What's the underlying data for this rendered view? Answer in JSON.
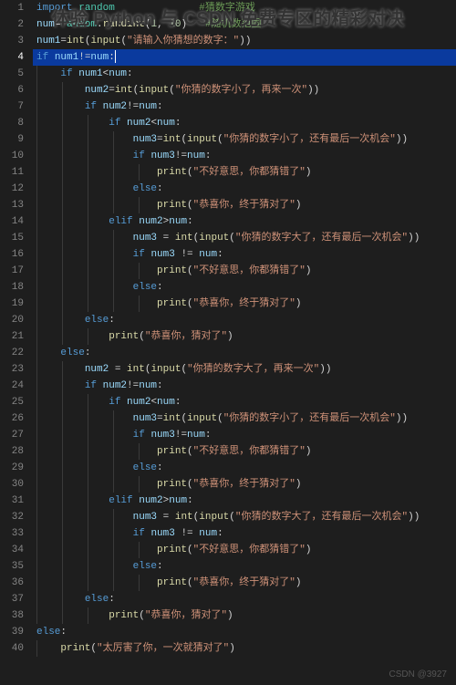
{
  "overlay_title": "体验 Python 与 CSDN 免费专区的精彩对决",
  "watermark": "CSDN @3927",
  "active_line": 4,
  "lines": [
    {
      "n": 1,
      "indent": 0,
      "tokens": [
        [
          "kw",
          "import"
        ],
        [
          "op",
          " "
        ],
        [
          "mod",
          "random"
        ],
        [
          "op",
          "              "
        ],
        [
          "cmt",
          "#猜数字游戏"
        ]
      ]
    },
    {
      "n": 2,
      "indent": 0,
      "tokens": [
        [
          "var",
          "num"
        ],
        [
          "op",
          "="
        ],
        [
          "mod",
          "random"
        ],
        [
          "punc",
          "."
        ],
        [
          "fn",
          "randint"
        ],
        [
          "punc",
          "("
        ],
        [
          "num",
          "1"
        ],
        [
          "punc",
          ", "
        ],
        [
          "num",
          "10"
        ],
        [
          "punc",
          ")   "
        ],
        [
          "cmt",
          "#随机数范围"
        ]
      ]
    },
    {
      "n": 3,
      "indent": 0,
      "tokens": [
        [
          "var",
          "num1"
        ],
        [
          "op",
          "="
        ],
        [
          "fn",
          "int"
        ],
        [
          "punc",
          "("
        ],
        [
          "fn",
          "input"
        ],
        [
          "punc",
          "("
        ],
        [
          "str",
          "\"请输入你猜想的数字：\""
        ],
        [
          "punc",
          "))"
        ]
      ]
    },
    {
      "n": 4,
      "indent": 0,
      "tokens": [
        [
          "kw",
          "if "
        ],
        [
          "var",
          "num1"
        ],
        [
          "op",
          "!="
        ],
        [
          "var",
          "num"
        ],
        [
          "punc",
          ":"
        ]
      ]
    },
    {
      "n": 5,
      "indent": 1,
      "tokens": [
        [
          "kw",
          "if "
        ],
        [
          "var",
          "num1"
        ],
        [
          "op",
          "<"
        ],
        [
          "var",
          "num"
        ],
        [
          "punc",
          ":"
        ]
      ]
    },
    {
      "n": 6,
      "indent": 2,
      "tokens": [
        [
          "var",
          "num2"
        ],
        [
          "op",
          "="
        ],
        [
          "fn",
          "int"
        ],
        [
          "punc",
          "("
        ],
        [
          "fn",
          "input"
        ],
        [
          "punc",
          "("
        ],
        [
          "str",
          "\"你猜的数字小了，再来一次\""
        ],
        [
          "punc",
          "))"
        ]
      ]
    },
    {
      "n": 7,
      "indent": 2,
      "tokens": [
        [
          "kw",
          "if "
        ],
        [
          "var",
          "num2"
        ],
        [
          "op",
          "!="
        ],
        [
          "var",
          "num"
        ],
        [
          "punc",
          ":"
        ]
      ]
    },
    {
      "n": 8,
      "indent": 3,
      "tokens": [
        [
          "kw",
          "if "
        ],
        [
          "var",
          "num2"
        ],
        [
          "op",
          "<"
        ],
        [
          "var",
          "num"
        ],
        [
          "punc",
          ":"
        ]
      ]
    },
    {
      "n": 9,
      "indent": 4,
      "tokens": [
        [
          "var",
          "num3"
        ],
        [
          "op",
          "="
        ],
        [
          "fn",
          "int"
        ],
        [
          "punc",
          "("
        ],
        [
          "fn",
          "input"
        ],
        [
          "punc",
          "("
        ],
        [
          "str",
          "\"你猜的数字小了，还有最后一次机会\""
        ],
        [
          "punc",
          "))"
        ]
      ]
    },
    {
      "n": 10,
      "indent": 4,
      "tokens": [
        [
          "kw",
          "if "
        ],
        [
          "var",
          "num3"
        ],
        [
          "op",
          "!="
        ],
        [
          "var",
          "num"
        ],
        [
          "punc",
          ":"
        ]
      ]
    },
    {
      "n": 11,
      "indent": 5,
      "tokens": [
        [
          "fn",
          "print"
        ],
        [
          "punc",
          "("
        ],
        [
          "str",
          "\"不好意思，你都猜错了\""
        ],
        [
          "punc",
          ")"
        ]
      ]
    },
    {
      "n": 12,
      "indent": 4,
      "tokens": [
        [
          "kw",
          "else"
        ],
        [
          "punc",
          ":"
        ]
      ]
    },
    {
      "n": 13,
      "indent": 5,
      "tokens": [
        [
          "fn",
          "print"
        ],
        [
          "punc",
          "("
        ],
        [
          "str",
          "\"恭喜你，终于猜对了\""
        ],
        [
          "punc",
          ")"
        ]
      ]
    },
    {
      "n": 14,
      "indent": 3,
      "tokens": [
        [
          "kw",
          "elif "
        ],
        [
          "var",
          "num2"
        ],
        [
          "op",
          ">"
        ],
        [
          "var",
          "num"
        ],
        [
          "punc",
          ":"
        ]
      ]
    },
    {
      "n": 15,
      "indent": 4,
      "tokens": [
        [
          "var",
          "num3"
        ],
        [
          "op",
          " = "
        ],
        [
          "fn",
          "int"
        ],
        [
          "punc",
          "("
        ],
        [
          "fn",
          "input"
        ],
        [
          "punc",
          "("
        ],
        [
          "str",
          "\"你猜的数字大了，还有最后一次机会\""
        ],
        [
          "punc",
          "))"
        ]
      ]
    },
    {
      "n": 16,
      "indent": 4,
      "tokens": [
        [
          "kw",
          "if "
        ],
        [
          "var",
          "num3"
        ],
        [
          "op",
          " != "
        ],
        [
          "var",
          "num"
        ],
        [
          "punc",
          ":"
        ]
      ]
    },
    {
      "n": 17,
      "indent": 5,
      "tokens": [
        [
          "fn",
          "print"
        ],
        [
          "punc",
          "("
        ],
        [
          "str",
          "\"不好意思，你都猜错了\""
        ],
        [
          "punc",
          ")"
        ]
      ]
    },
    {
      "n": 18,
      "indent": 4,
      "tokens": [
        [
          "kw",
          "else"
        ],
        [
          "punc",
          ":"
        ]
      ]
    },
    {
      "n": 19,
      "indent": 5,
      "tokens": [
        [
          "fn",
          "print"
        ],
        [
          "punc",
          "("
        ],
        [
          "str",
          "\"恭喜你，终于猜对了\""
        ],
        [
          "punc",
          ")"
        ]
      ]
    },
    {
      "n": 20,
      "indent": 2,
      "tokens": [
        [
          "kw",
          "else"
        ],
        [
          "punc",
          ":"
        ]
      ]
    },
    {
      "n": 21,
      "indent": 3,
      "tokens": [
        [
          "fn",
          "print"
        ],
        [
          "punc",
          "("
        ],
        [
          "str",
          "\"恭喜你，猜对了\""
        ],
        [
          "punc",
          ")"
        ]
      ]
    },
    {
      "n": 22,
      "indent": 1,
      "tokens": [
        [
          "kw",
          "else"
        ],
        [
          "punc",
          ":"
        ]
      ]
    },
    {
      "n": 23,
      "indent": 2,
      "tokens": [
        [
          "var",
          "num2"
        ],
        [
          "op",
          " = "
        ],
        [
          "fn",
          "int"
        ],
        [
          "punc",
          "("
        ],
        [
          "fn",
          "input"
        ],
        [
          "punc",
          "("
        ],
        [
          "str",
          "\"你猜的数字大了，再来一次\""
        ],
        [
          "punc",
          "))"
        ]
      ]
    },
    {
      "n": 24,
      "indent": 2,
      "tokens": [
        [
          "kw",
          "if "
        ],
        [
          "var",
          "num2"
        ],
        [
          "op",
          "!="
        ],
        [
          "var",
          "num"
        ],
        [
          "punc",
          ":"
        ]
      ]
    },
    {
      "n": 25,
      "indent": 3,
      "tokens": [
        [
          "kw",
          "if "
        ],
        [
          "var",
          "num2"
        ],
        [
          "op",
          "<"
        ],
        [
          "var",
          "num"
        ],
        [
          "punc",
          ":"
        ]
      ]
    },
    {
      "n": 26,
      "indent": 4,
      "tokens": [
        [
          "var",
          "num3"
        ],
        [
          "op",
          "="
        ],
        [
          "fn",
          "int"
        ],
        [
          "punc",
          "("
        ],
        [
          "fn",
          "input"
        ],
        [
          "punc",
          "("
        ],
        [
          "str",
          "\"你猜的数字小了，还有最后一次机会\""
        ],
        [
          "punc",
          "))"
        ]
      ]
    },
    {
      "n": 27,
      "indent": 4,
      "tokens": [
        [
          "kw",
          "if "
        ],
        [
          "var",
          "num3"
        ],
        [
          "op",
          "!="
        ],
        [
          "var",
          "num"
        ],
        [
          "punc",
          ":"
        ]
      ]
    },
    {
      "n": 28,
      "indent": 5,
      "tokens": [
        [
          "fn",
          "print"
        ],
        [
          "punc",
          "("
        ],
        [
          "str",
          "\"不好意思，你都猜错了\""
        ],
        [
          "punc",
          ")"
        ]
      ]
    },
    {
      "n": 29,
      "indent": 4,
      "tokens": [
        [
          "kw",
          "else"
        ],
        [
          "punc",
          ":"
        ]
      ]
    },
    {
      "n": 30,
      "indent": 5,
      "tokens": [
        [
          "fn",
          "print"
        ],
        [
          "punc",
          "("
        ],
        [
          "str",
          "\"恭喜你，终于猜对了\""
        ],
        [
          "punc",
          ")"
        ]
      ]
    },
    {
      "n": 31,
      "indent": 3,
      "tokens": [
        [
          "kw",
          "elif "
        ],
        [
          "var",
          "num2"
        ],
        [
          "op",
          ">"
        ],
        [
          "var",
          "num"
        ],
        [
          "punc",
          ":"
        ]
      ]
    },
    {
      "n": 32,
      "indent": 4,
      "tokens": [
        [
          "var",
          "num3"
        ],
        [
          "op",
          " = "
        ],
        [
          "fn",
          "int"
        ],
        [
          "punc",
          "("
        ],
        [
          "fn",
          "input"
        ],
        [
          "punc",
          "("
        ],
        [
          "str",
          "\"你猜的数字大了，还有最后一次机会\""
        ],
        [
          "punc",
          "))"
        ]
      ]
    },
    {
      "n": 33,
      "indent": 4,
      "tokens": [
        [
          "kw",
          "if "
        ],
        [
          "var",
          "num3"
        ],
        [
          "op",
          " != "
        ],
        [
          "var",
          "num"
        ],
        [
          "punc",
          ":"
        ]
      ]
    },
    {
      "n": 34,
      "indent": 5,
      "tokens": [
        [
          "fn",
          "print"
        ],
        [
          "punc",
          "("
        ],
        [
          "str",
          "\"不好意思，你都猜错了\""
        ],
        [
          "punc",
          ")"
        ]
      ]
    },
    {
      "n": 35,
      "indent": 4,
      "tokens": [
        [
          "kw",
          "else"
        ],
        [
          "punc",
          ":"
        ]
      ]
    },
    {
      "n": 36,
      "indent": 5,
      "tokens": [
        [
          "fn",
          "print"
        ],
        [
          "punc",
          "("
        ],
        [
          "str",
          "\"恭喜你，终于猜对了\""
        ],
        [
          "punc",
          ")"
        ]
      ]
    },
    {
      "n": 37,
      "indent": 2,
      "tokens": [
        [
          "kw",
          "else"
        ],
        [
          "punc",
          ":"
        ]
      ]
    },
    {
      "n": 38,
      "indent": 3,
      "tokens": [
        [
          "fn",
          "print"
        ],
        [
          "punc",
          "("
        ],
        [
          "str",
          "\"恭喜你，猜对了\""
        ],
        [
          "punc",
          ")"
        ]
      ]
    },
    {
      "n": 39,
      "indent": 0,
      "tokens": [
        [
          "kw",
          "else"
        ],
        [
          "punc",
          ":"
        ]
      ]
    },
    {
      "n": 40,
      "indent": 1,
      "tokens": [
        [
          "fn",
          "print"
        ],
        [
          "punc",
          "("
        ],
        [
          "str",
          "\"太厉害了你，一次就猜对了\""
        ],
        [
          "punc",
          ")"
        ]
      ]
    }
  ]
}
